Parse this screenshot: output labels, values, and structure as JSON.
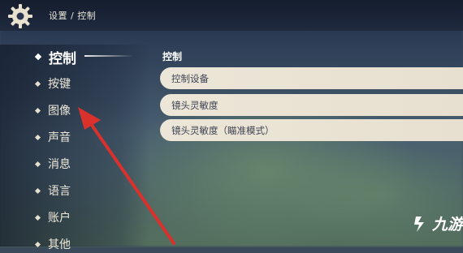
{
  "header": {
    "breadcrumb": "设置 / 控制"
  },
  "sidebar": {
    "items": [
      {
        "label": "控制",
        "active": true
      },
      {
        "label": "按键"
      },
      {
        "label": "图像"
      },
      {
        "label": "声音"
      },
      {
        "label": "消息"
      },
      {
        "label": "语言"
      },
      {
        "label": "账户"
      },
      {
        "label": "其他"
      }
    ]
  },
  "main": {
    "section_title": "控制",
    "options": [
      {
        "label": "控制设备"
      },
      {
        "label": "镜头灵敏度"
      },
      {
        "label": "镜头灵敏度（瞄准模式）"
      }
    ]
  },
  "watermark": {
    "text": "九游"
  },
  "icons": {
    "settings": "gear-icon",
    "annotation": "red-arrow-annotation",
    "watermark_logo": "jiuyou-logo-icon"
  },
  "colors": {
    "option_bg": "#ece6d8",
    "option_text": "#3d4352",
    "annotation_arrow": "#d9312b"
  }
}
